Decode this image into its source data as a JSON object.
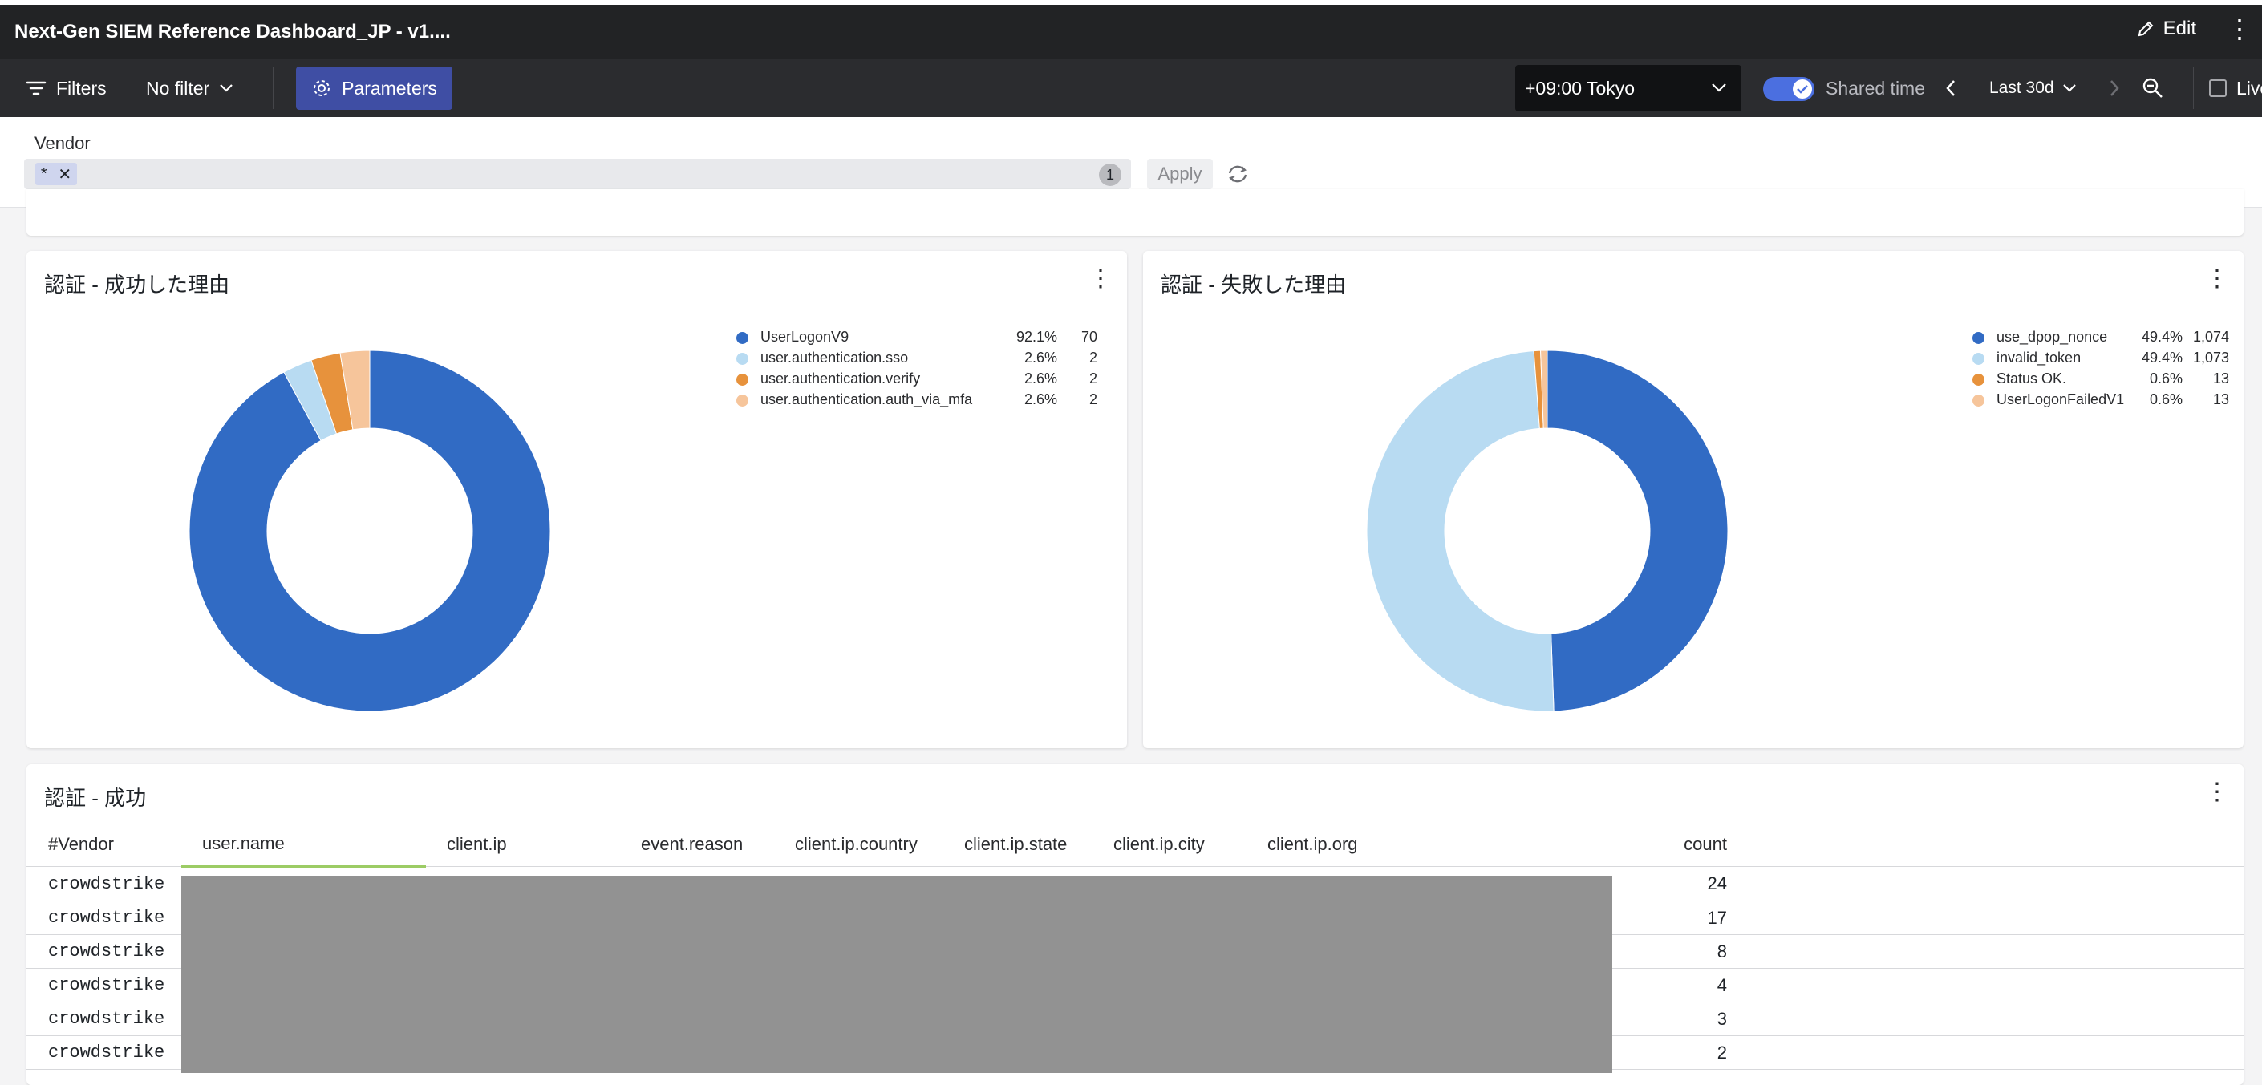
{
  "header": {
    "title": "Next-Gen SIEM Reference Dashboard_JP - v1....",
    "edit_label": "Edit"
  },
  "toolbar": {
    "filters_label": "Filters",
    "no_filter_label": "No filter",
    "parameters_label": "Parameters",
    "timezone": "+09:00 Tokyo",
    "shared_time_label": "Shared time",
    "shared_time_on": true,
    "range_label": "Last 30d",
    "live_label": "Live"
  },
  "vendor_param": {
    "label": "Vendor",
    "chip_value": "*",
    "count": "1",
    "apply_label": "Apply"
  },
  "panel_success_reasons": {
    "title": "認証 - 成功した理由",
    "legend": [
      {
        "name": "UserLogonV9",
        "pct": "92.1%",
        "count": "70",
        "color": "#316bc4"
      },
      {
        "name": "user.authentication.sso",
        "pct": "2.6%",
        "count": "2",
        "color": "#b8dbf2"
      },
      {
        "name": "user.authentication.verify",
        "pct": "2.6%",
        "count": "2",
        "color": "#e7923c"
      },
      {
        "name": "user.authentication.auth_via_mfa",
        "pct": "2.6%",
        "count": "2",
        "color": "#f6c59b"
      }
    ]
  },
  "panel_failure_reasons": {
    "title": "認証 - 失敗した理由",
    "legend": [
      {
        "name": "use_dpop_nonce",
        "pct": "49.4%",
        "count": "1,074",
        "color": "#316bc4"
      },
      {
        "name": "invalid_token",
        "pct": "49.4%",
        "count": "1,073",
        "color": "#b8dbf2"
      },
      {
        "name": "Status OK.",
        "pct": "0.6%",
        "count": "13",
        "color": "#e7923c"
      },
      {
        "name": "UserLogonFailedV1",
        "pct": "0.6%",
        "count": "13",
        "color": "#f6c59b"
      }
    ]
  },
  "chart_data": [
    {
      "type": "pie",
      "title": "認証 - 成功した理由",
      "categories": [
        "UserLogonV9",
        "user.authentication.sso",
        "user.authentication.verify",
        "user.authentication.auth_via_mfa"
      ],
      "values": [
        70,
        2,
        2,
        2
      ],
      "colors": [
        "#316bc4",
        "#b8dbf2",
        "#e7923c",
        "#f6c59b"
      ],
      "legend": "top-right"
    },
    {
      "type": "pie",
      "title": "認証 - 失敗した理由",
      "categories": [
        "use_dpop_nonce",
        "invalid_token",
        "Status OK.",
        "UserLogonFailedV1"
      ],
      "values": [
        1074,
        1073,
        13,
        13
      ],
      "colors": [
        "#316bc4",
        "#b8dbf2",
        "#e7923c",
        "#f6c59b"
      ],
      "legend": "top-right"
    }
  ],
  "table_panel": {
    "title": "認証 - 成功",
    "columns": [
      "#Vendor",
      "user.name",
      "client.ip",
      "event.reason",
      "client.ip.country",
      "client.ip.state",
      "client.ip.city",
      "client.ip.org",
      "count"
    ],
    "rows": [
      {
        "vendor": "crowdstrike",
        "count": "24"
      },
      {
        "vendor": "crowdstrike",
        "count": "17"
      },
      {
        "vendor": "crowdstrike",
        "count": "8"
      },
      {
        "vendor": "crowdstrike",
        "count": "4"
      },
      {
        "vendor": "crowdstrike",
        "count": "3"
      },
      {
        "vendor": "crowdstrike",
        "count": "2"
      }
    ]
  }
}
